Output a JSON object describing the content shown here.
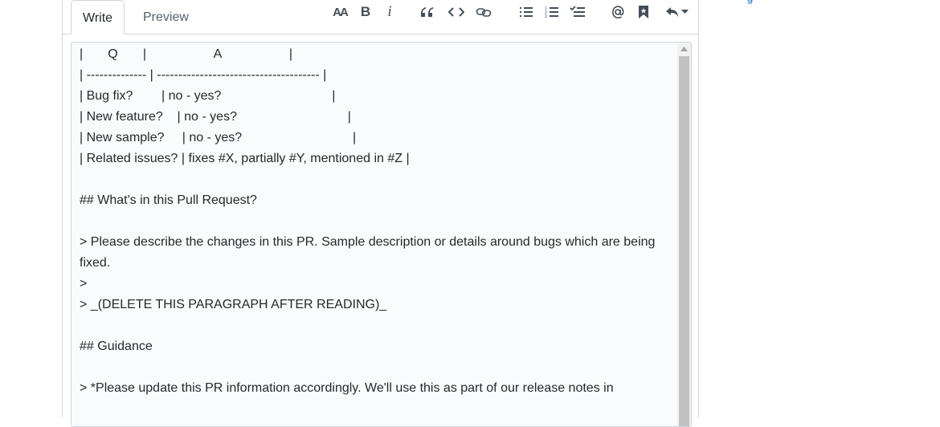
{
  "side": {
    "link_fragment": "g"
  },
  "tabs": {
    "write": "Write",
    "preview": "Preview"
  },
  "toolbar": {
    "heading": "AA",
    "bold": "B",
    "italic": "i"
  },
  "editor": {
    "lines": [
      "|       Q       |                   A                   |",
      "| -------------- | -------------------------------------- |",
      "| Bug fix?        | no - yes?                               |",
      "| New feature?    | no - yes?                               |",
      "| New sample?     | no - yes?                               |",
      "| Related issues? | fixes #X, partially #Y, mentioned in #Z |",
      "",
      "## What's in this Pull Request?",
      "",
      "> Please describe the changes in this PR. Sample description or details around bugs which are being fixed.",
      ">",
      "> _(DELETE THIS PARAGRAPH AFTER READING)_",
      "",
      "## Guidance",
      "",
      "> *Please update this PR information accordingly. We'll use this as part of our release notes in"
    ]
  }
}
